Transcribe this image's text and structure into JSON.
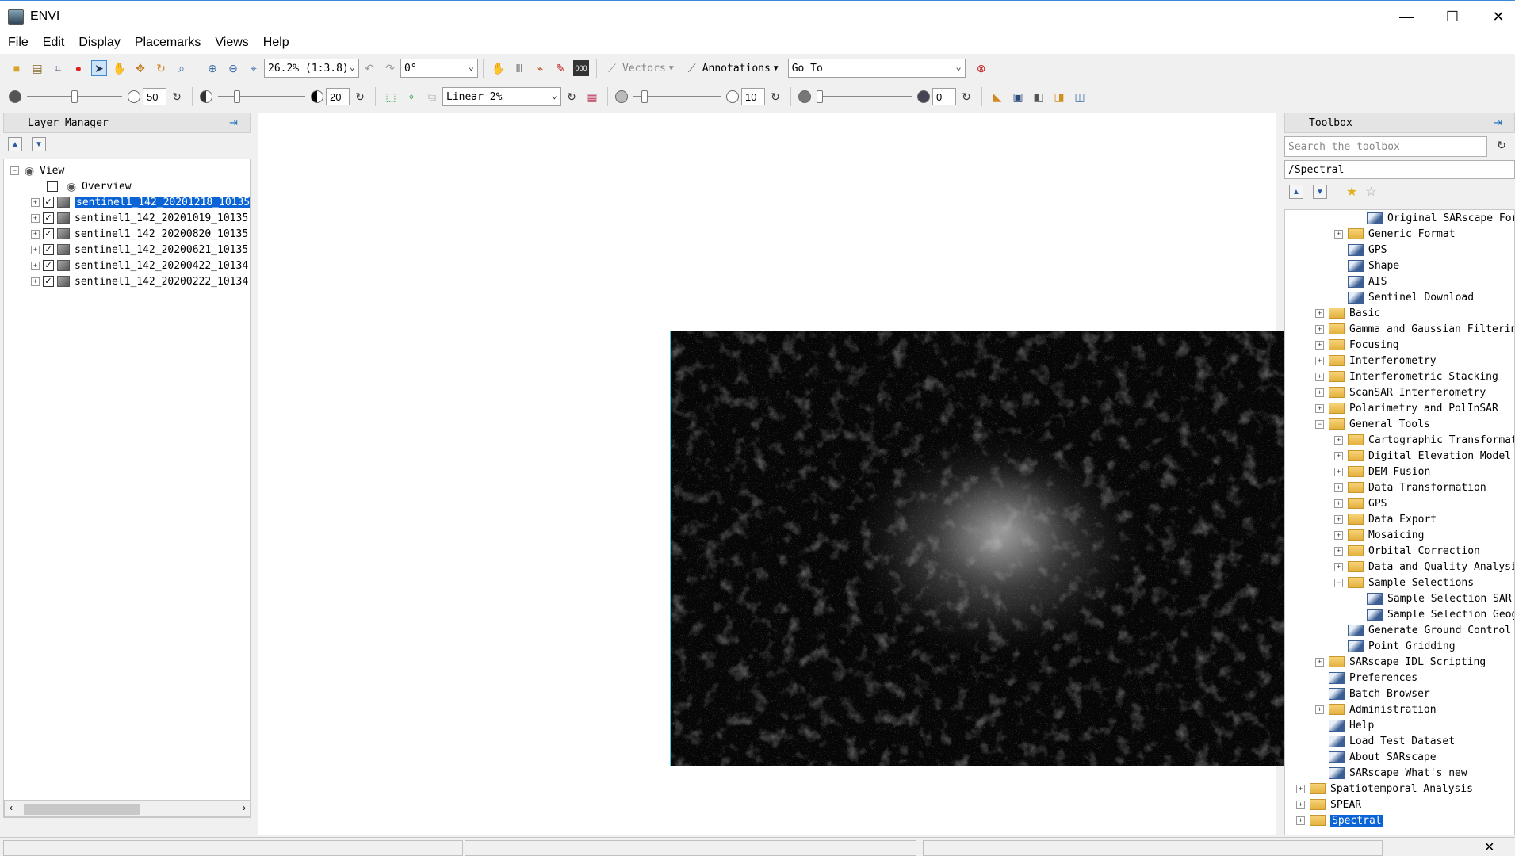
{
  "window": {
    "title": "ENVI",
    "minimize": "—",
    "maximize": "☐",
    "close": "✕"
  },
  "menu": [
    "File",
    "Edit",
    "Display",
    "Placemarks",
    "Views",
    "Help"
  ],
  "toolbar1": {
    "zoom_value": "26.2% (1:3.8)",
    "rotation_value": "0°",
    "vectors_label": "Vectors",
    "annotations_label": "Annotations",
    "goto_value": "Go To"
  },
  "toolbar2": {
    "brightness": "50",
    "contrast": "20",
    "stretch": "Linear 2%",
    "sharpen": "10",
    "transparency": "0",
    "brightness_level": 0.5,
    "contrast_level": 0.2,
    "sharpen_level": 0.1,
    "transparency_level": 0.0
  },
  "layer_manager": {
    "title": "Layer Manager",
    "root": "View",
    "overview": "Overview",
    "layers": [
      {
        "name": "sentinel1_142_20201218_10135",
        "checked": true,
        "selected": true
      },
      {
        "name": "sentinel1_142_20201019_10135",
        "checked": true,
        "selected": false
      },
      {
        "name": "sentinel1_142_20200820_10135",
        "checked": true,
        "selected": false
      },
      {
        "name": "sentinel1_142_20200621_10135",
        "checked": true,
        "selected": false
      },
      {
        "name": "sentinel1_142_20200422_10134",
        "checked": true,
        "selected": false
      },
      {
        "name": "sentinel1_142_20200222_10134",
        "checked": true,
        "selected": false
      }
    ]
  },
  "toolbox": {
    "title": "Toolbox",
    "search_placeholder": "Search the toolbox",
    "path": "/Spectral",
    "items": [
      {
        "label": "Original SARscape Form",
        "level": 3,
        "kind": "tool",
        "exp": ""
      },
      {
        "label": "Generic Format",
        "level": 2,
        "kind": "folder",
        "exp": "+"
      },
      {
        "label": "GPS",
        "level": 2,
        "kind": "tool",
        "exp": ""
      },
      {
        "label": "Shape",
        "level": 2,
        "kind": "tool",
        "exp": ""
      },
      {
        "label": "AIS",
        "level": 2,
        "kind": "tool",
        "exp": ""
      },
      {
        "label": "Sentinel Download",
        "level": 2,
        "kind": "tool",
        "exp": ""
      },
      {
        "label": "Basic",
        "level": 1,
        "kind": "folder",
        "exp": "+"
      },
      {
        "label": "Gamma and Gaussian Filtering",
        "level": 1,
        "kind": "folder",
        "exp": "+"
      },
      {
        "label": "Focusing",
        "level": 1,
        "kind": "folder",
        "exp": "+"
      },
      {
        "label": "Interferometry",
        "level": 1,
        "kind": "folder",
        "exp": "+"
      },
      {
        "label": "Interferometric Stacking",
        "level": 1,
        "kind": "folder",
        "exp": "+"
      },
      {
        "label": "ScanSAR Interferometry",
        "level": 1,
        "kind": "folder",
        "exp": "+"
      },
      {
        "label": "Polarimetry and PolInSAR",
        "level": 1,
        "kind": "folder",
        "exp": "+"
      },
      {
        "label": "General Tools",
        "level": 1,
        "kind": "folder",
        "exp": "−"
      },
      {
        "label": "Cartographic Transformati",
        "level": 2,
        "kind": "folder",
        "exp": "+"
      },
      {
        "label": "Digital Elevation Model E",
        "level": 2,
        "kind": "folder",
        "exp": "+"
      },
      {
        "label": "DEM Fusion",
        "level": 2,
        "kind": "folder",
        "exp": "+"
      },
      {
        "label": "Data Transformation",
        "level": 2,
        "kind": "folder",
        "exp": "+"
      },
      {
        "label": "GPS",
        "level": 2,
        "kind": "folder",
        "exp": "+"
      },
      {
        "label": "Data Export",
        "level": 2,
        "kind": "folder",
        "exp": "+"
      },
      {
        "label": "Mosaicing",
        "level": 2,
        "kind": "folder",
        "exp": "+"
      },
      {
        "label": "Orbital Correction",
        "level": 2,
        "kind": "folder",
        "exp": "+"
      },
      {
        "label": "Data and Quality Analysis",
        "level": 2,
        "kind": "folder",
        "exp": "+"
      },
      {
        "label": "Sample Selections",
        "level": 2,
        "kind": "folder",
        "exp": "−"
      },
      {
        "label": "Sample Selection SAR G",
        "level": 3,
        "kind": "tool",
        "exp": ""
      },
      {
        "label": "Sample Selection Geogr",
        "level": 3,
        "kind": "tool",
        "exp": ""
      },
      {
        "label": "Generate Ground Control P",
        "level": 2,
        "kind": "tool",
        "exp": ""
      },
      {
        "label": "Point Gridding",
        "level": 2,
        "kind": "tool",
        "exp": ""
      },
      {
        "label": "SARscape IDL Scripting",
        "level": 1,
        "kind": "folder",
        "exp": "+"
      },
      {
        "label": "Preferences",
        "level": 1,
        "kind": "tool",
        "exp": ""
      },
      {
        "label": "Batch Browser",
        "level": 1,
        "kind": "tool",
        "exp": ""
      },
      {
        "label": "Administration",
        "level": 1,
        "kind": "folder",
        "exp": "+"
      },
      {
        "label": "Help",
        "level": 1,
        "kind": "tool",
        "exp": ""
      },
      {
        "label": "Load Test Dataset",
        "level": 1,
        "kind": "tool",
        "exp": ""
      },
      {
        "label": "About SARscape",
        "level": 1,
        "kind": "tool",
        "exp": ""
      },
      {
        "label": "SARscape What's new",
        "level": 1,
        "kind": "tool",
        "exp": ""
      },
      {
        "label": "Spatiotemporal Analysis",
        "level": 0,
        "kind": "folder",
        "exp": "+"
      },
      {
        "label": "SPEAR",
        "level": 0,
        "kind": "folder",
        "exp": "+"
      },
      {
        "label": "Spectral",
        "level": 0,
        "kind": "folder",
        "exp": "+",
        "selected": true
      }
    ]
  },
  "colors": {
    "selection": "#0a64d6",
    "image_border": "#4ec9d8",
    "accent": "#3c8ad6"
  }
}
